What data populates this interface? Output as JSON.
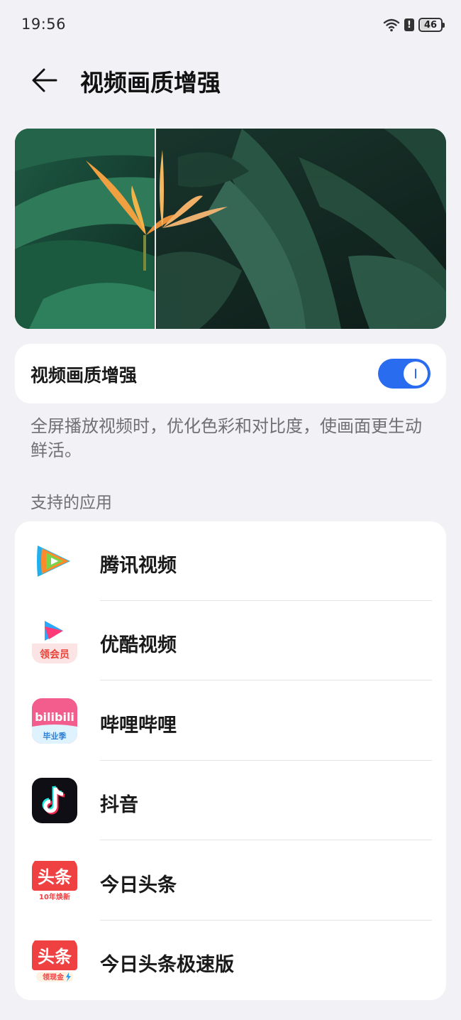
{
  "status_bar": {
    "time": "19:56",
    "battery_level": "46",
    "alert_glyph": "!"
  },
  "header": {
    "title": "视频画质增强",
    "back_icon": "arrow-left-icon"
  },
  "preview": {
    "image": "bird-of-paradise-flower-among-green-leaves",
    "split_divider": true
  },
  "toggle": {
    "label": "视频画质增强",
    "state": "on",
    "accent_color": "#2a6cf0"
  },
  "description": "全屏播放视频时，优化色彩和对比度，使画面更生动鲜活。",
  "supported_apps": {
    "title": "支持的应用",
    "items": [
      {
        "name": "腾讯视频",
        "icon": "tencent-video-icon"
      },
      {
        "name": "优酷视频",
        "icon": "youku-icon",
        "badge": "领会员"
      },
      {
        "name": "哔哩哔哩",
        "icon": "bilibili-icon",
        "logo_text": "bilibili",
        "badge": "毕业季"
      },
      {
        "name": "抖音",
        "icon": "douyin-icon"
      },
      {
        "name": "今日头条",
        "icon": "toutiao-icon",
        "logo_text": "头条",
        "badge": "10年焕新"
      },
      {
        "name": "今日头条极速版",
        "icon": "toutiao-lite-icon",
        "logo_text": "头条",
        "badge": "领现金"
      }
    ]
  }
}
